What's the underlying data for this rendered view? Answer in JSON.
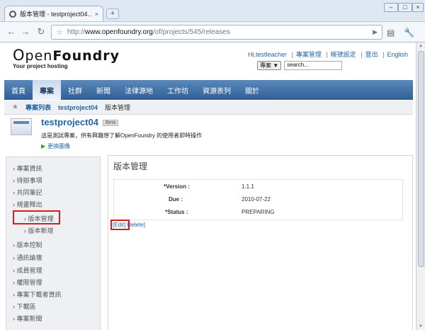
{
  "browser": {
    "tab_title": "版本管理 - testproject04…",
    "tab_close": "×",
    "new_tab": "+",
    "window_controls": [
      "–",
      "□",
      "×"
    ],
    "url_prefix": "http://",
    "url_domain": "www.openfoundry.org",
    "url_path": "/of/projects/545/releases"
  },
  "site": {
    "logo_o": "O",
    "logo_pen": "pen",
    "logo_foundry": "Foundry",
    "tagline": "Your project hosting"
  },
  "user_links": {
    "greeting": "Hi,",
    "username": "testleacher",
    "items": [
      "專案管理",
      "帳號設定",
      "登出",
      "English"
    ]
  },
  "search": {
    "scope": "專案 ▼",
    "placeholder": "search..."
  },
  "nav": [
    "首頁",
    "專案",
    "社群",
    "新聞",
    "法律源地",
    "工作坊",
    "資源表列",
    "關於"
  ],
  "breadcrumb": [
    "專案列表",
    "testproject04",
    "版本管理"
  ],
  "project": {
    "name": "testproject04",
    "badge": "Beta",
    "description": "這是測試專案，供有興趣想了解OpenFoundry 的使用者即時操作",
    "change_image": "更換圖像"
  },
  "sidebar": [
    "專案資訊",
    "待辦事項",
    "共同筆記",
    "規畫釋出",
    "版本管理",
    "版本新增",
    "版本控制",
    "通訊論壇",
    "成員管理",
    "權限管理",
    "專案下載者資訊",
    "下載區",
    "專案新聞"
  ],
  "content": {
    "title": "版本管理",
    "fields": [
      {
        "label": "*Version :",
        "value": "1.1.1"
      },
      {
        "label": "Due :",
        "value": "2010-07-22"
      },
      {
        "label": "*Status :",
        "value": "PREPARING"
      }
    ],
    "edit": "[Edit]",
    "delete": "Delete]"
  }
}
